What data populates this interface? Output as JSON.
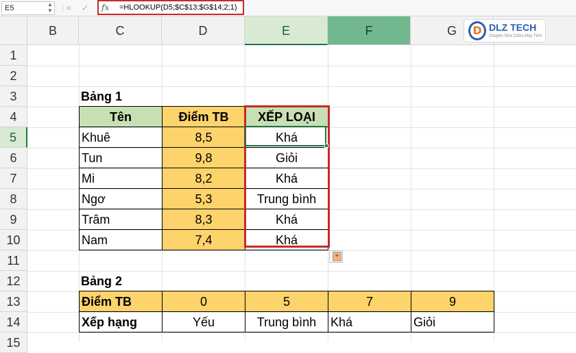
{
  "formula_bar": {
    "cell_ref": "E5",
    "fx": "fx",
    "formula": "=HLOOKUP(D5;$C$13:$G$14;2;1)",
    "cancel": "×",
    "enter": "✓",
    "dots": "⋮"
  },
  "columns": [
    "B",
    "C",
    "D",
    "E",
    "F",
    "G"
  ],
  "rows": [
    "1",
    "2",
    "3",
    "4",
    "5",
    "6",
    "7",
    "8",
    "9",
    "10",
    "11",
    "12",
    "13",
    "14",
    "15"
  ],
  "logo": {
    "text": "DLZ TECH",
    "letter": "D",
    "tagline": "Chuyên Sửa Chữa Máy Tính"
  },
  "table1": {
    "title": "Bảng 1",
    "headers": {
      "name": "Tên",
      "score": "Điểm TB",
      "grade": "XẾP LOẠI"
    },
    "rows": [
      {
        "name": "Khuê",
        "score": "8,5",
        "grade": "Khá"
      },
      {
        "name": "Tun",
        "score": "9,8",
        "grade": "Giỏi"
      },
      {
        "name": "Mi",
        "score": "8,2",
        "grade": "Khá"
      },
      {
        "name": "Ngơ",
        "score": "5,3",
        "grade": "Trung bình"
      },
      {
        "name": "Trâm",
        "score": "8,3",
        "grade": "Khá"
      },
      {
        "name": "Nam",
        "score": "7,4",
        "grade": "Khá"
      }
    ]
  },
  "table2": {
    "title": "Bảng 2",
    "row1_label": "Điểm TB",
    "row2_label": "Xếp hạng",
    "thresholds": [
      "0",
      "5",
      "7",
      "9"
    ],
    "ranks": [
      "Yếu",
      "Trung bình",
      "Khá",
      "Giỏi"
    ]
  },
  "colors": {
    "accent_red": "#c62828",
    "header_green": "#c6e0b4",
    "score_orange": "#fdd36b",
    "excel_green": "#217346"
  }
}
